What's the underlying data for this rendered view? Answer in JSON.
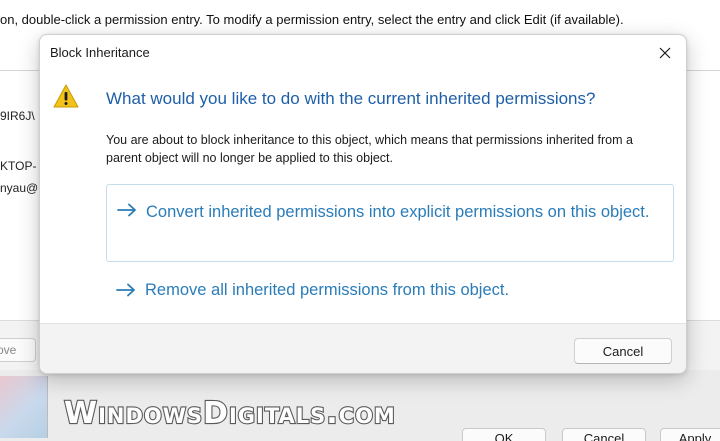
{
  "background": {
    "instruction": "on, double-click a permission entry. To modify a permission entry, select the entry and click Edit (if available).",
    "list_items": [
      "9IR6J\\",
      "KTOP-",
      "nyau@"
    ],
    "remove_label": "ove",
    "ok_label": "OK",
    "cancel_label": "Cancel",
    "apply_label": "Apply"
  },
  "watermark": {
    "text": "WindowsDigitals.com"
  },
  "dialog": {
    "title": "Block Inheritance",
    "close_icon": "close-icon",
    "warning_icon": "warning-icon",
    "question": "What would you like to do with the current inherited permissions?",
    "description": "You are about to block inheritance to this object, which means that permissions inherited from a parent object will no longer be applied to this object.",
    "options": [
      {
        "label": "Convert inherited permissions into explicit permissions on this object."
      },
      {
        "label": "Remove all inherited permissions from this object."
      }
    ],
    "cancel_label": "Cancel"
  },
  "colors": {
    "question": "#1e5fa8",
    "command_link": "#2a7cb8",
    "warning_fill": "#f2c218"
  }
}
